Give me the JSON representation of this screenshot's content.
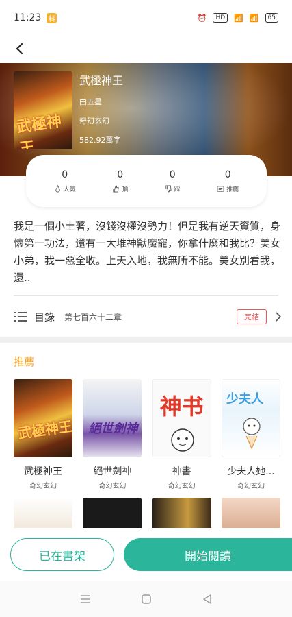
{
  "status_bar": {
    "time": "11:23",
    "badge": "料",
    "net": "HD",
    "battery": "65"
  },
  "book": {
    "title": "武極神王",
    "author": "由五星",
    "genre": "奇幻玄幻",
    "word_count": "582.92萬字",
    "cover_text": "武極神王"
  },
  "stats": [
    {
      "value": "0",
      "label": "人氣",
      "icon": "fire-icon"
    },
    {
      "value": "0",
      "label": "頂",
      "icon": "thumbs-up-icon"
    },
    {
      "value": "0",
      "label": "踩",
      "icon": "thumbs-down-icon"
    },
    {
      "value": "0",
      "label": "推薦",
      "icon": "recommend-icon"
    }
  ],
  "description": "我是一個小土著，沒錢沒權沒勢力！但是我有逆天資質，身懷第一功法，還有一大堆神獸魔寵，你拿什麼和我比？美女小弟，我一惡全收。上天入地，我無所不能。美女別看我，還..",
  "catalog": {
    "label": "目錄",
    "latest_chapter": "第七百六十二章",
    "status": "完結"
  },
  "recommend": {
    "title": "推薦",
    "items": [
      {
        "name": "武極神王",
        "genre": "奇幻玄幻",
        "cover_text": "武極神王"
      },
      {
        "name": "絕世劍神",
        "genre": "奇幻玄幻",
        "cover_text": "絕世劍神"
      },
      {
        "name": "神書",
        "genre": "奇幻玄幻",
        "cover_text": "神书"
      },
      {
        "name": "少夫人她...",
        "genre": "奇幻玄幻",
        "cover_text": "少夫人"
      }
    ]
  },
  "actions": {
    "shelf": "已在書架",
    "read": "開始閱讀"
  },
  "colors": {
    "accent": "#2bb59a",
    "recommend": "#f0a020",
    "complete": "#e55555"
  }
}
